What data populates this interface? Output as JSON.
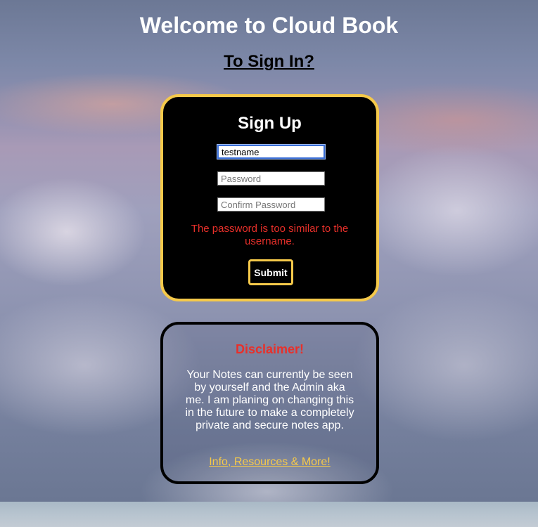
{
  "header": {
    "title": "Welcome to Cloud Book",
    "signin_link": "To Sign In?"
  },
  "signup_form": {
    "title": "Sign Up",
    "username_value": "testname",
    "password_placeholder": "Password",
    "confirm_placeholder": "Confirm Password",
    "error_message": "The password is too similar to the username.",
    "submit_label": "Submit"
  },
  "disclaimer": {
    "title": "Disclaimer!",
    "text": "Your Notes can currently be seen by yourself and the Admin aka me. I am planing on changing this in the future to make a completely private and secure notes app.",
    "link_label": "Info, Resources & More!"
  },
  "colors": {
    "accent_yellow": "#f5c94a",
    "error_red": "#e8302a",
    "card_black": "#000000",
    "title_white": "#ffffff"
  }
}
